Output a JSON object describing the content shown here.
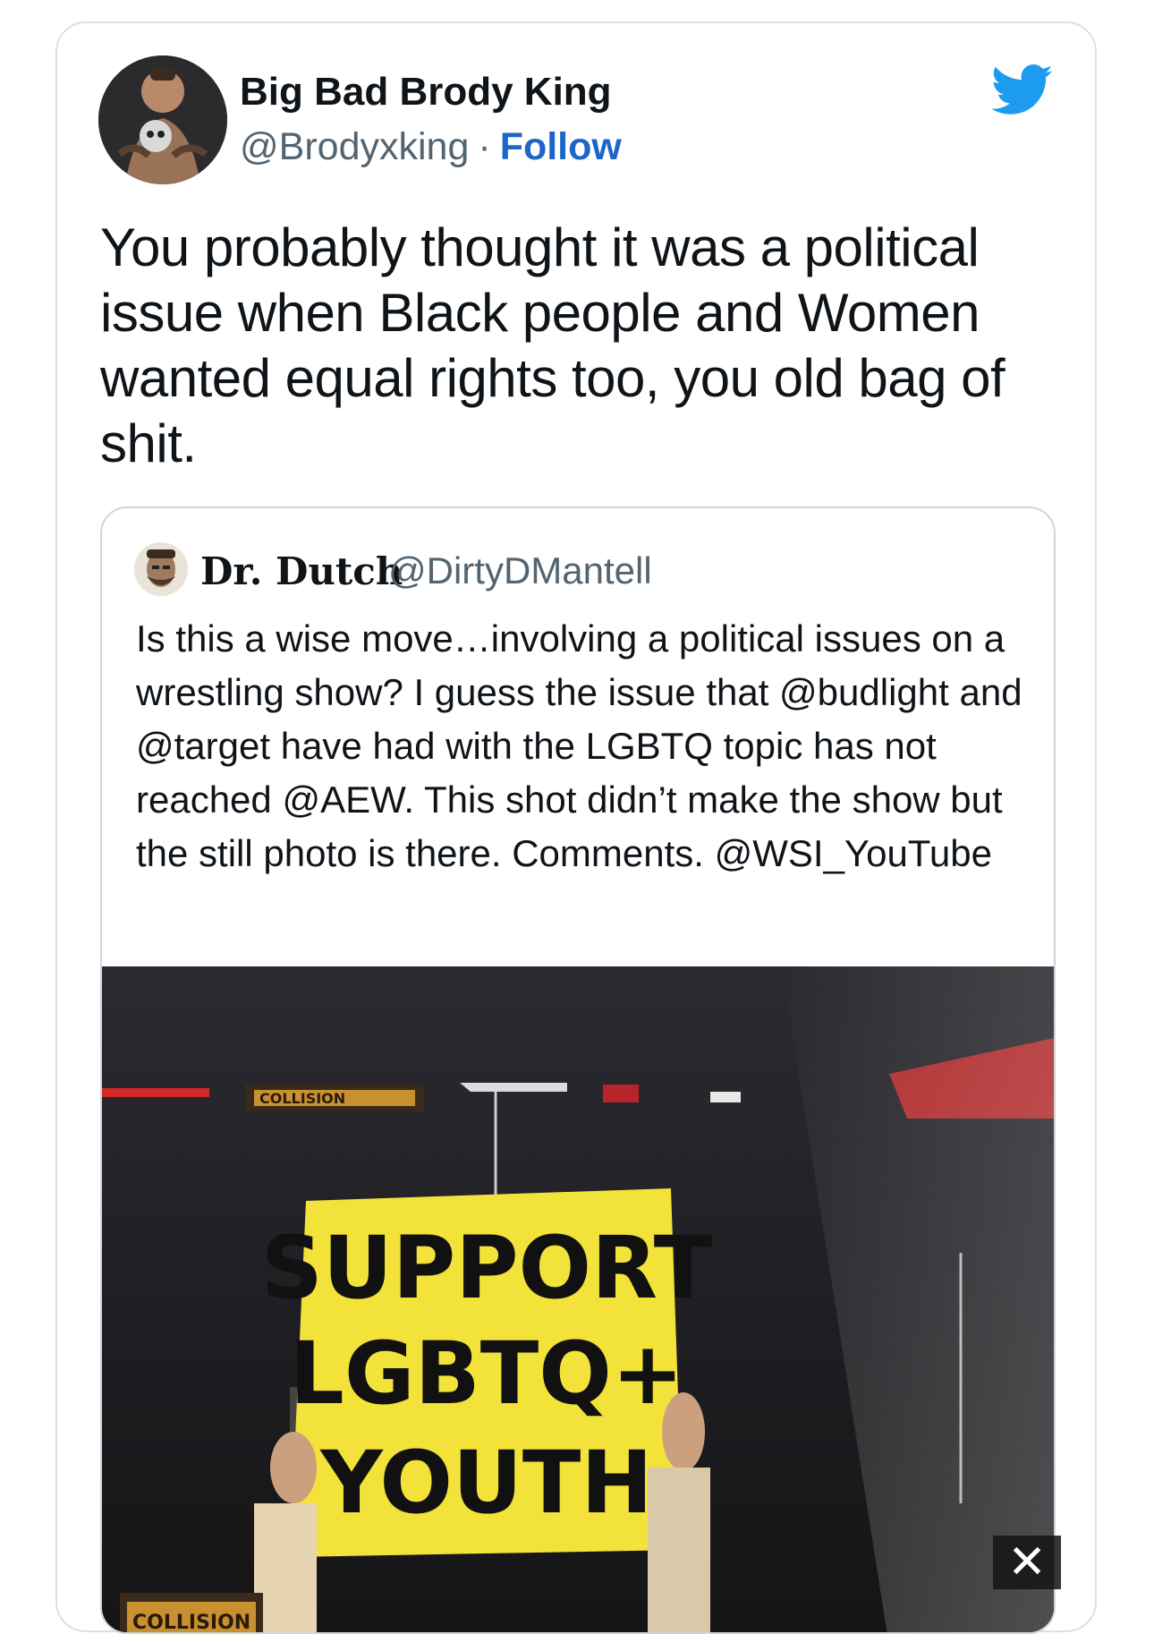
{
  "tweet": {
    "author_name": "Big Bad Brody King",
    "author_handle": "@Brodyxking",
    "separator": "·",
    "follow_label": "Follow",
    "text": "You probably thought it was a political issue when Black people and Women wanted equal rights too, you old bag of shit."
  },
  "quoted_tweet": {
    "author_name": "Dr. Dutch",
    "author_handle": "@DirtyDMantell",
    "text": "Is this a wise move…involving a political issues on a wrestling show?  I guess the issue that @budlight and @target have had with the LGBTQ topic has  not reached @AEW.  This shot didn’t make the show but the still photo is there.  Comments. @WSI_YouTube",
    "photo": {
      "sign_lines": [
        "SUPPORT",
        "LGBTQ+",
        "YOUTH"
      ],
      "signage_text": "COLLISION"
    }
  },
  "icons": {
    "platform": "twitter-bird-icon",
    "close": "close-icon"
  },
  "colors": {
    "brand_blue": "#1d9bf0",
    "follow_blue": "#1d66c9",
    "text": "#0f1419",
    "muted": "#536471",
    "border": "#dcdfe3",
    "sign_yellow": "#f2e23a"
  },
  "close_glyph": "✕"
}
